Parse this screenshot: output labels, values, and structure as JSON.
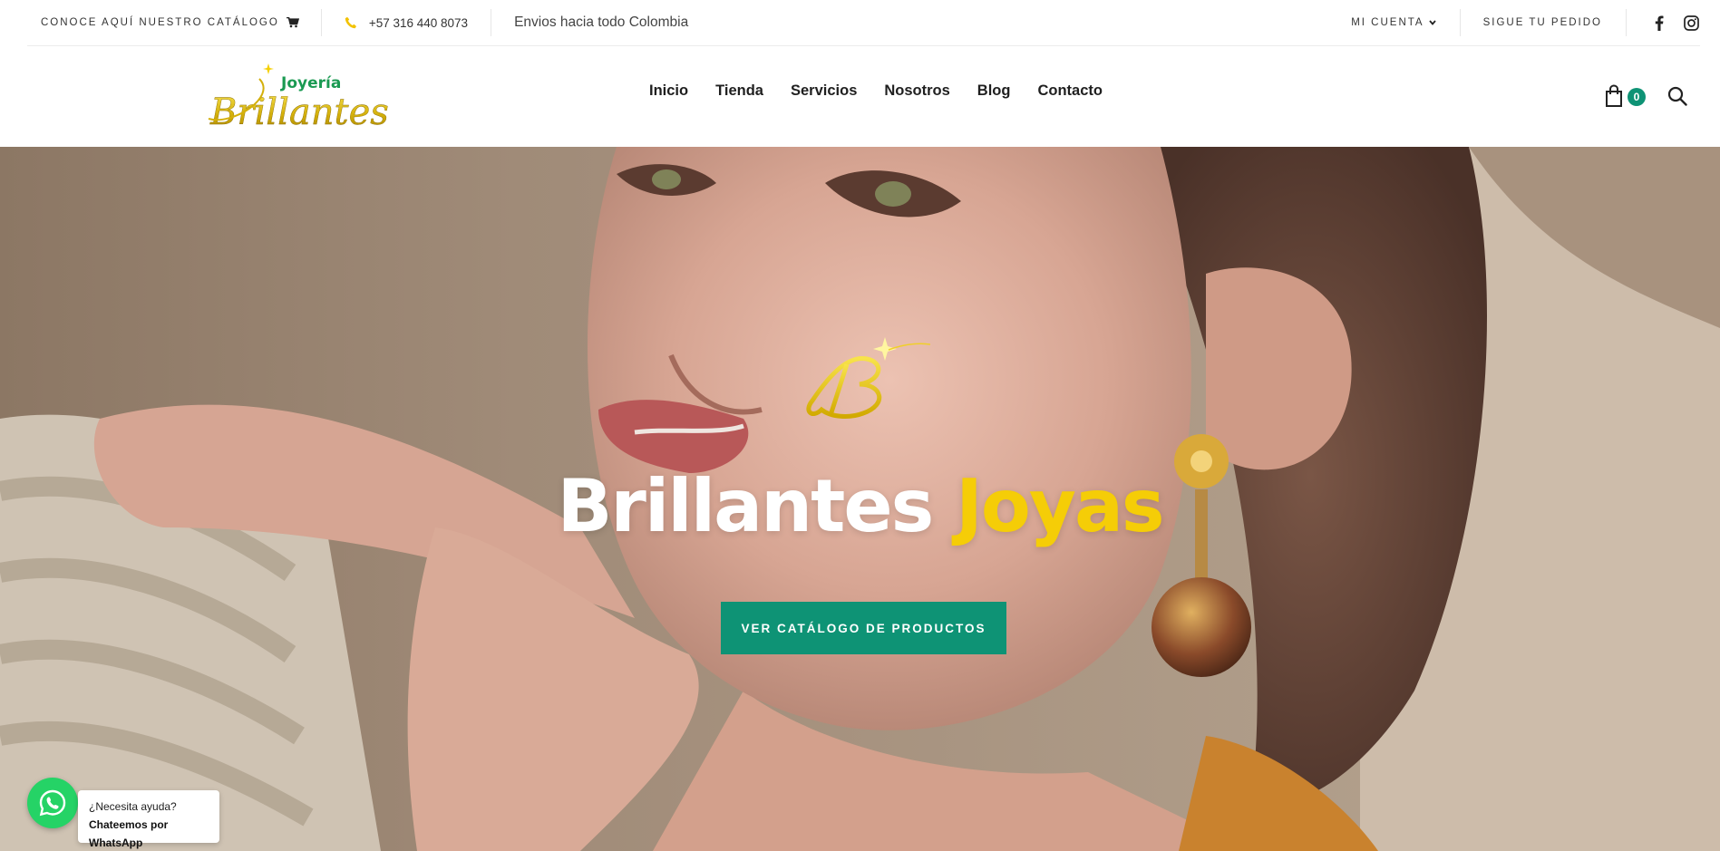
{
  "topbar": {
    "catalog_label": "CONOCE AQUÍ NUESTRO CATÁLOGO",
    "catalog_icon": "cart-icon",
    "phone_icon": "phone-icon",
    "phone": "+57 316 440 8073",
    "shipping": "Envios hacia todo Colombia",
    "account_label": "MI CUENTA",
    "account_icon": "chevron-down-icon",
    "track_label": "SIGUE TU PEDIDO",
    "social": [
      "facebook-icon",
      "instagram-icon"
    ]
  },
  "header": {
    "logo": {
      "top_word": "Joyería",
      "main_word": "Brillantes"
    },
    "nav": [
      "Inicio",
      "Tienda",
      "Servicios",
      "Nosotros",
      "Blog",
      "Contacto"
    ],
    "cart_count": "0",
    "search_icon": "search-icon"
  },
  "hero": {
    "title_main": "Brillantes",
    "title_accent": "Joyas",
    "cta": "VER CATÁLOGO DE PRODUCTOS"
  },
  "whatsapp": {
    "line1": "¿Necesita ayuda?",
    "line2": "Chateemos por WhatsApp"
  },
  "colors": {
    "accent_green": "#0e9375",
    "gold": "#f5cd07",
    "logo_green": "#1a9a52",
    "whatsapp": "#25d366"
  }
}
